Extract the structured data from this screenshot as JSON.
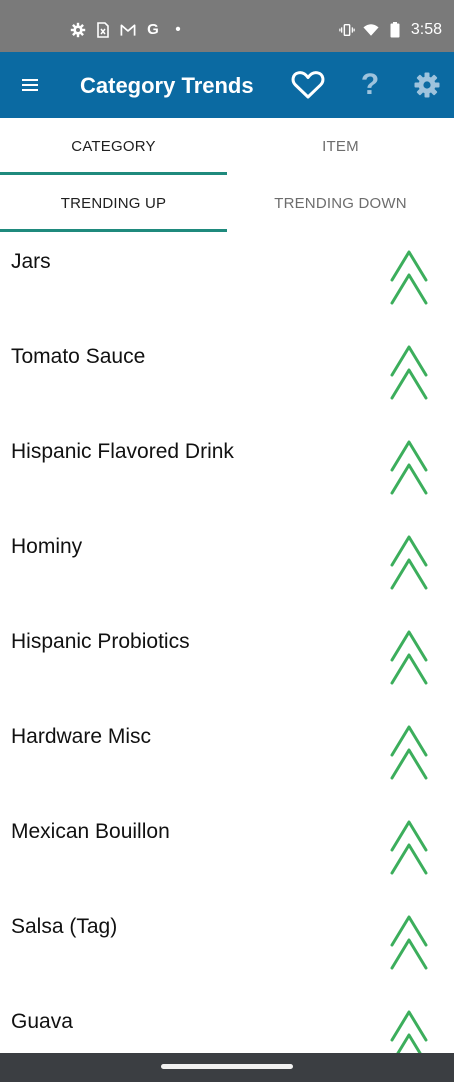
{
  "status_bar": {
    "time": "3:58",
    "notif_g": "G",
    "notif_dot": "•",
    "left_icons": [
      "gear-icon",
      "document-x-icon",
      "gmail-icon",
      "google-g-icon",
      "dot-icon"
    ],
    "right_icons": [
      "vibrate-icon",
      "wifi-icon",
      "battery-icon"
    ]
  },
  "app_bar": {
    "title": "Category Trends",
    "help_glyph": "?",
    "background": "#0b6aa2",
    "icons": [
      "menu-icon",
      "heart-icon",
      "help-icon",
      "settings-icon"
    ]
  },
  "tabs": {
    "main": [
      {
        "label": "CATEGORY",
        "active": true
      },
      {
        "label": "ITEM",
        "active": false
      }
    ],
    "sub": [
      {
        "label": "TRENDING UP",
        "active": true
      },
      {
        "label": "TRENDING DOWN",
        "active": false
      }
    ],
    "indicator_color": "#1f8a7d"
  },
  "list": {
    "trend_icon": "trending-up-double-chevron-icon",
    "trend_color": "#3cae5c",
    "items": [
      {
        "label": "Jars"
      },
      {
        "label": "Tomato Sauce"
      },
      {
        "label": "Hispanic Flavored Drink"
      },
      {
        "label": "Hominy"
      },
      {
        "label": "Hispanic Probiotics"
      },
      {
        "label": "Hardware Misc"
      },
      {
        "label": "Mexican Bouillon"
      },
      {
        "label": "Salsa (Tag)"
      },
      {
        "label": "Guava"
      }
    ]
  }
}
